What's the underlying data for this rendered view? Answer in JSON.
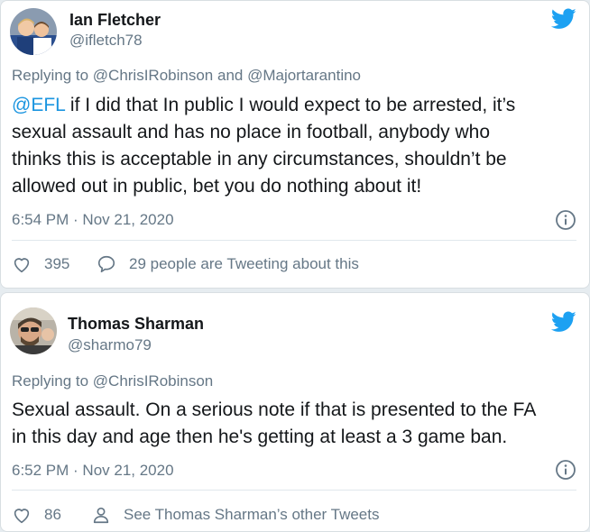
{
  "tweets": [
    {
      "name": "Ian Fletcher",
      "handle": "@ifletch78",
      "replying_prefix": "Replying to ",
      "replying_to_1": "@ChrisIRobinson",
      "replying_and": " and ",
      "replying_to_2": "@Majortarantino",
      "mention": "@EFL",
      "text_line_1": " if I did that In public I would expect to be arrested, it’s",
      "text_line_2": "sexual assault and has no place in football, anybody who",
      "text_line_3": "thinks this is acceptable in any circumstances, shouldn’t be",
      "text_line_4": "allowed out in public, bet you do nothing about it!",
      "timestamp": "6:54 PM · Nov 21, 2020",
      "likes": "395",
      "conversation": "29 people are Tweeting about this",
      "icons": [
        "twitter-bird-icon",
        "info-icon",
        "heart-icon",
        "comment-icon"
      ]
    },
    {
      "name": "Thomas Sharman",
      "handle": "@sharmo79",
      "replying_prefix": "Replying to ",
      "replying_to_1": "@ChrisIRobinson",
      "text_line_1": "Sexual assault. On a serious note if that is presented to the FA",
      "text_line_2": "in this day and age then he's getting at least a 3 game ban.",
      "timestamp": "6:52 PM · Nov 21, 2020",
      "likes": "86",
      "profile_link": "See Thomas Sharman’s other Tweets",
      "icons": [
        "twitter-bird-icon",
        "info-icon",
        "heart-icon",
        "person-icon"
      ]
    }
  ],
  "colors": {
    "twitter_blue": "#1da1f2",
    "link_blue": "#1b95e0",
    "secondary_text": "#657786",
    "primary_text": "#14171a"
  }
}
